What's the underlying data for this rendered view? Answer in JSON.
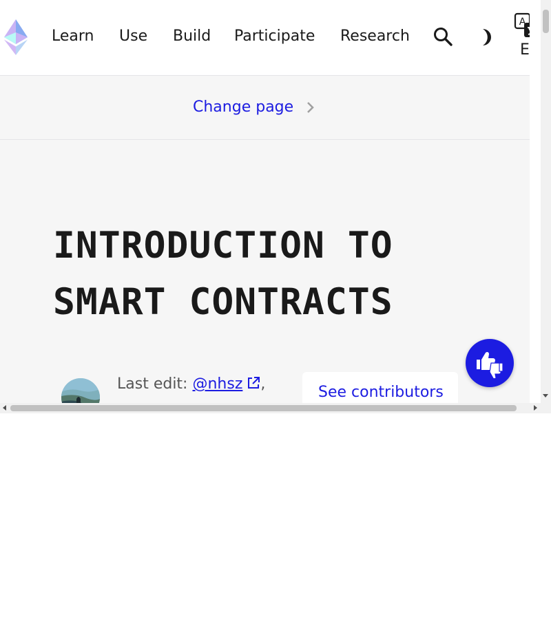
{
  "nav": {
    "logo_icon": "ethereum-logo-icon",
    "items": [
      {
        "label": "Learn"
      },
      {
        "label": "Use"
      },
      {
        "label": "Build"
      },
      {
        "label": "Participate"
      },
      {
        "label": "Research"
      }
    ],
    "search_icon": "search-icon",
    "theme_icon": "dark-mode-icon",
    "language": {
      "icon": "translate-icon",
      "label": "EN"
    }
  },
  "change_page": {
    "label": "Change page",
    "icon": "chevron-right-icon"
  },
  "hero": {
    "title": "INTRODUCTION TO SMART CONTRACTS",
    "last_edit_prefix": "Last edit:",
    "editor": "@nhsz",
    "editor_suffix": ",",
    "see_contributors": "See contributors"
  },
  "feedback": {
    "icon": "thumbs-up-down-icon"
  },
  "colors": {
    "accent": "#1c1ce1",
    "text": "#1a1a1a",
    "muted_text": "#555555",
    "hero_background": "#f6f6f6"
  }
}
